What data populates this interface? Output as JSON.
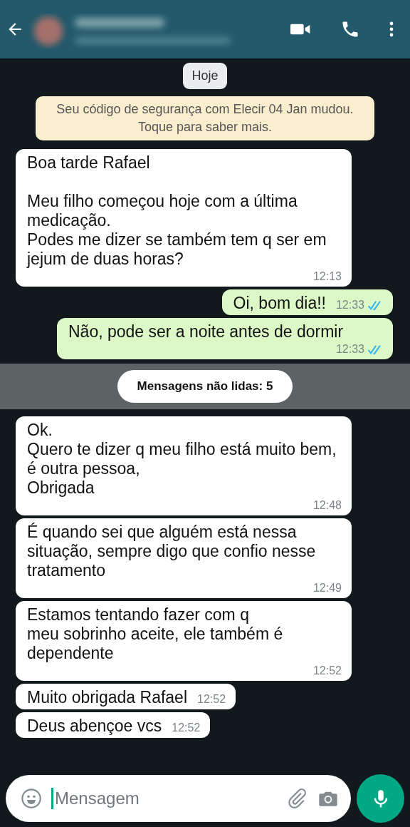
{
  "date_chip": "Hoje",
  "security_notice": "Seu código de segurança com Elecir 04 Jan mudou.\nToque para saber mais.",
  "messages_before": [
    {
      "kind": "incoming",
      "text": "Boa tarde Rafael\n\nMeu filho começou hoje com a última medicação.\nPodes me dizer se também tem q ser em jejum de duas horas?",
      "time": "12:13"
    },
    {
      "kind": "outgoing",
      "text": "Oi, bom dia!!",
      "time": "12:33",
      "read": true
    },
    {
      "kind": "outgoing",
      "text": "Não, pode ser a noite antes de dormir",
      "time": "12:33",
      "read": true
    }
  ],
  "unread_banner": "Mensagens não lidas: 5",
  "messages_after": [
    {
      "kind": "incoming",
      "text": "Ok.\nQuero te dizer q meu filho está muito bem, é outra pessoa,\nObrigada",
      "time": "12:48"
    },
    {
      "kind": "incoming",
      "text": "É quando sei que alguém está nessa situação, sempre digo que confio nesse tratamento",
      "time": "12:49"
    },
    {
      "kind": "incoming",
      "text": "Estamos tentando fazer com q\nmeu sobrinho aceite, ele também é dependente",
      "time": "12:52"
    },
    {
      "kind": "incoming",
      "text": "Muito obrigada Rafael",
      "time": "12:52"
    },
    {
      "kind": "incoming",
      "text": "Deus abençoe vcs",
      "time": "12:52"
    }
  ],
  "composer": {
    "placeholder": "Mensagem"
  }
}
